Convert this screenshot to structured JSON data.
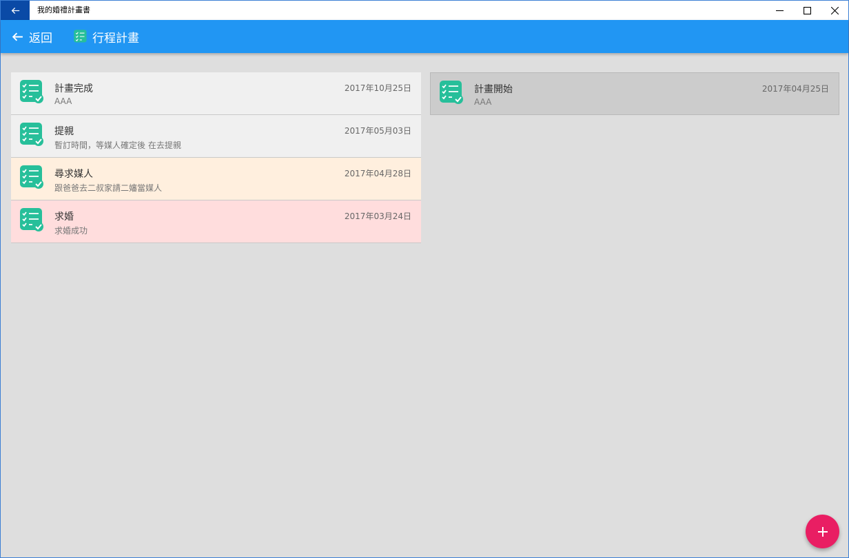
{
  "window": {
    "title": "我的婚禮計畫書",
    "back_icon": "arrow-left-icon",
    "controls": [
      "minimize-icon",
      "maximize-icon",
      "close-icon"
    ]
  },
  "appbar": {
    "back_label": "返回",
    "page_title": "行程計畫",
    "page_icon": "checklist-icon",
    "color": "#2196f3"
  },
  "left_list": [
    {
      "title": "計畫完成",
      "subtitle": "AAA",
      "date": "2017年10月25日",
      "bg": "#f0f0f0",
      "icon": "checklist-icon"
    },
    {
      "title": "提親",
      "subtitle": "暫訂時間，等媒人確定後 在去提親",
      "date": "2017年05月03日",
      "bg": "#f0f0f0",
      "icon": "checklist-icon"
    },
    {
      "title": "尋求媒人",
      "subtitle": "跟爸爸去二叔家請二嬸當媒人",
      "date": "2017年04月28日",
      "bg": "#ffefde",
      "icon": "checklist-icon"
    },
    {
      "title": "求婚",
      "subtitle": "求婚成功",
      "date": "2017年03月24日",
      "bg": "#ffdddd",
      "icon": "checklist-icon"
    }
  ],
  "right_list": [
    {
      "title": "計畫開始",
      "subtitle": "AAA",
      "date": "2017年04月25日",
      "bg": "#cccccc",
      "icon": "checklist-icon"
    }
  ],
  "fab": {
    "icon": "plus-icon",
    "color": "#e91e63"
  },
  "icon_color": "#27bf9a"
}
